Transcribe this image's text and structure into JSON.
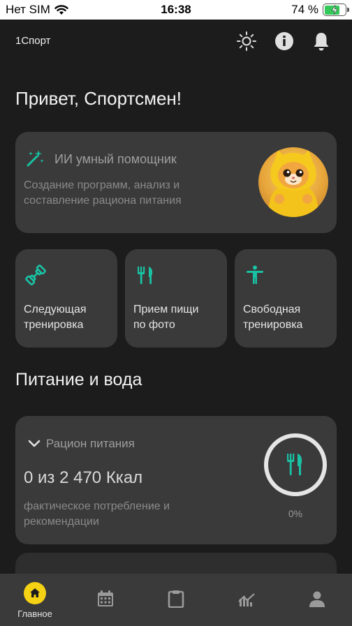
{
  "status_bar": {
    "carrier": "Нет SIM",
    "time": "16:38",
    "battery_percent": "74 %",
    "battery_level": 0.74
  },
  "header": {
    "app_name": "1Спорт",
    "icons": [
      "brightness-icon",
      "info-icon",
      "bell-icon"
    ]
  },
  "greeting": "Привет, Спортсмен!",
  "ai_card": {
    "title": "ИИ умный помощник",
    "description": "Создание программ, анализ и составление рациона питания",
    "icon": "magic-wand-icon"
  },
  "tiles": [
    {
      "label_line1": "Следующая",
      "label_line2": "тренировка",
      "icon": "dumbbell-icon"
    },
    {
      "label_line1": "Прием пищи",
      "label_line2": "по фото",
      "icon": "cutlery-icon"
    },
    {
      "label_line1": "Свободная",
      "label_line2": "тренировка",
      "icon": "person-stretch-icon"
    }
  ],
  "section_title": "Питание и вода",
  "nutrition": {
    "header": "Рацион питания",
    "value": "0 из 2 470 Ккал",
    "description": "фактическое потребление и рекомендации",
    "percent": "0%",
    "progress": 0
  },
  "tabbar": {
    "items": [
      {
        "label": "Главное",
        "icon": "home-icon",
        "active": true
      },
      {
        "label": "",
        "icon": "calendar-icon"
      },
      {
        "label": "",
        "icon": "clipboard-icon"
      },
      {
        "label": "",
        "icon": "chart-icon"
      },
      {
        "label": "",
        "icon": "profile-icon"
      }
    ]
  },
  "colors": {
    "background": "#1c1c1c",
    "card": "#3a3a3a",
    "accent_teal": "#19c2a4",
    "active_tab": "#f6d215"
  }
}
